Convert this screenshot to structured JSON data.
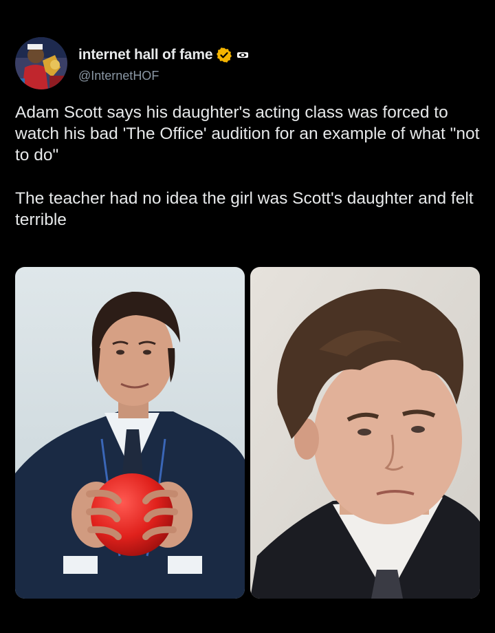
{
  "tweet": {
    "display_name": "internet hall of fame",
    "handle": "@InternetHOF",
    "verified_icon": "verified-badge-icon",
    "affiliation_icon": "affiliate-badge-icon",
    "paragraphs": [
      "Adam Scott says his daughter's acting class was forced to watch his bad 'The Office' audition for an example of what \"not to do\"",
      "The teacher had no idea the girl was Scott's daughter and felt terrible"
    ]
  },
  "colors": {
    "background": "#000000",
    "text": "#e7e9ea",
    "handle": "#8b98a5",
    "verified": "#f4b400"
  }
}
